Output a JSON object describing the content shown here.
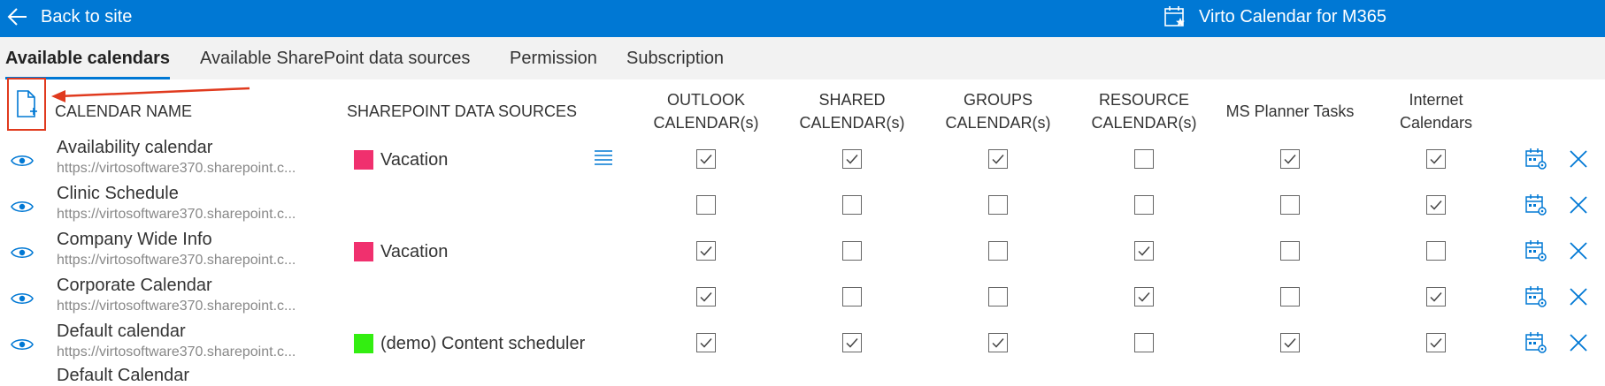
{
  "topbar": {
    "back_label": "Back to site",
    "app_title": "Virto Calendar for M365"
  },
  "tabs": [
    {
      "label": "Available calendars",
      "active": true
    },
    {
      "label": "Available SharePoint data sources",
      "active": false
    },
    {
      "label": "Permission",
      "active": false
    },
    {
      "label": "Subscription",
      "active": false
    }
  ],
  "table": {
    "headers": {
      "name": "CALENDAR NAME",
      "datasources": "SHAREPOINT DATA SOURCES",
      "outlook": [
        "OUTLOOK",
        "CALENDAR(s)"
      ],
      "shared": [
        "SHARED",
        "CALENDAR(s)"
      ],
      "groups": [
        "GROUPS",
        "CALENDAR(s)"
      ],
      "resource": [
        "RESOURCE",
        "CALENDAR(s)"
      ],
      "planner": [
        "MS Planner Tasks"
      ],
      "internet": [
        "Internet",
        "Calendars"
      ]
    },
    "rows": [
      {
        "name": "Availability calendar",
        "url": "https://virtosoftware370.sharepoint.c...",
        "datasource": {
          "label": "Vacation",
          "color": "#f0306e"
        },
        "checks": [
          true,
          true,
          true,
          false,
          true,
          true
        ]
      },
      {
        "name": "Clinic Schedule",
        "url": "https://virtosoftware370.sharepoint.c...",
        "datasource": null,
        "checks": [
          false,
          false,
          false,
          false,
          false,
          true
        ]
      },
      {
        "name": "Company Wide Info",
        "url": "https://virtosoftware370.sharepoint.c...",
        "datasource": {
          "label": "Vacation",
          "color": "#f0306e"
        },
        "checks": [
          true,
          false,
          false,
          true,
          false,
          false
        ]
      },
      {
        "name": "Corporate Calendar",
        "url": "https://virtosoftware370.sharepoint.c...",
        "datasource": null,
        "checks": [
          true,
          false,
          false,
          true,
          false,
          true
        ]
      },
      {
        "name": "Default calendar",
        "url": "https://virtosoftware370.sharepoint.c...",
        "datasource": {
          "label": "(demo) Content scheduler",
          "color": "#33ee11"
        },
        "checks": [
          true,
          true,
          true,
          false,
          true,
          true
        ]
      }
    ],
    "peek_row_name": "Default Calendar"
  },
  "icons": {
    "back": "back-arrow-icon",
    "app": "calendar-icon",
    "add": "add-document-icon",
    "view": "eye-icon",
    "menu": "list-icon",
    "settings": "calendar-settings-icon",
    "delete": "close-icon"
  },
  "colors": {
    "accent": "#0078d4",
    "highlight": "#e03a1e"
  }
}
